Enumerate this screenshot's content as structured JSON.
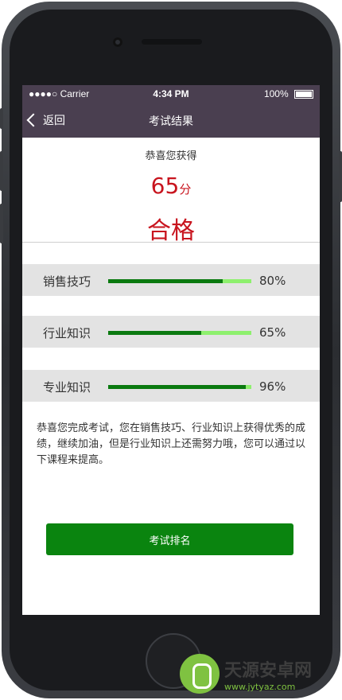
{
  "status_bar": {
    "carrier": "●●●●○ Carrier",
    "time": "4:34 PM",
    "battery": "100%"
  },
  "nav": {
    "back_label": "返回",
    "title": "考试结果"
  },
  "result": {
    "congrats": "恭喜您获得",
    "score": "65",
    "score_unit": "分",
    "verdict": "合格"
  },
  "skills": [
    {
      "label": "销售技巧",
      "percent": 80,
      "percent_text": "80%"
    },
    {
      "label": "行业知识",
      "percent": 65,
      "percent_text": "65%"
    },
    {
      "label": "专业知识",
      "percent": 96,
      "percent_text": "96%"
    }
  ],
  "message": "恭喜您完成考试，您在销售技巧、行业知识上获得优秀的成绩，继续加油，但是行业知识上还需努力哦，您可以通过以下课程来提高。",
  "buttons": {
    "rank": "考试排名"
  },
  "colors": {
    "nav_bg": "#4a3f50",
    "score_red": "#c8141e",
    "bar_fill": "#0b7a10",
    "bar_track": "#8ef06e",
    "button_green": "#0a840f"
  },
  "watermark": {
    "title": "天源安卓网",
    "url": "www.jytyaz.com"
  }
}
